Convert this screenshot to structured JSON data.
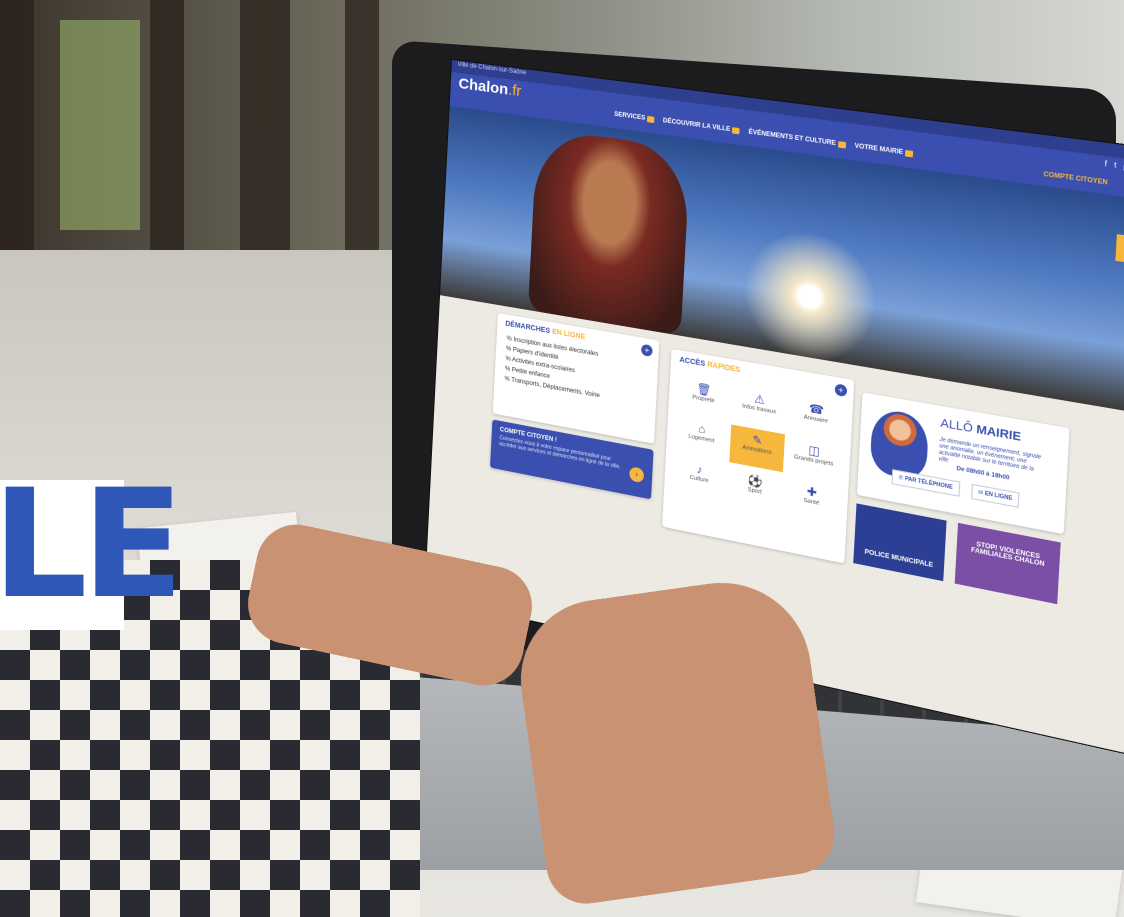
{
  "overlay": {
    "big_letters": "LE"
  },
  "site": {
    "topbar": "Ville de Chalon-sur-Saône",
    "brand": {
      "name": "Chalon",
      "tld": ".fr"
    },
    "nav": [
      "SERVICES",
      "DÉCOUVRIR LA VILLE",
      "ÉVÉNEMENTS ET CULTURE",
      "VOTRE MAIRIE"
    ],
    "social_icons": [
      "f",
      "t",
      "▶",
      "◎"
    ],
    "account_label": "COMPTE CITOYEN",
    "search_icon": "⌕",
    "demarches": {
      "title_prefix": "DÉMARCHES",
      "title_accent": "EN LIGNE",
      "links": [
        "% Inscription aux listes électorales",
        "% Papiers d'identité",
        "% Activités extra-scolaires",
        "% Petite enfance",
        "% Transports, Déplacements, Voirie"
      ]
    },
    "citizen": {
      "title": "COMPTE CITOYEN !",
      "text": "Connectez-vous à votre espace personnalisé pour accéder aux services et démarches en ligne de la ville."
    },
    "acces": {
      "title_prefix": "ACCÈS",
      "title_accent": "RAPIDES",
      "tiles": [
        {
          "label": "Propreté",
          "icon": "🗑"
        },
        {
          "label": "Infos travaux",
          "icon": "⚠"
        },
        {
          "label": "Annuaire",
          "icon": "☎"
        },
        {
          "label": "Logement",
          "icon": "⌂"
        },
        {
          "label": "Animations",
          "icon": "✎"
        },
        {
          "label": "Grands projets",
          "icon": "◫"
        },
        {
          "label": "Culture",
          "icon": "♪"
        },
        {
          "label": "Sport",
          "icon": "⚽"
        },
        {
          "label": "Santé",
          "icon": "✚"
        }
      ]
    },
    "allo": {
      "title_prefix": "ALLÔ",
      "title_bold": "MAIRIE",
      "text": "Je demande un renseignement, signale une anomalie, un événement, une actualité notable sur le territoire de la ville",
      "hours": "De 08h00 à 18h00",
      "phone_button": "PAR TÉLÉPHONE",
      "online_button": "EN LIGNE"
    },
    "banners": {
      "police": "POLICE MUNICIPALE",
      "violence": "STOP! VIOLENCES FAMILIALES CHALON"
    }
  },
  "colors": {
    "brand_blue": "#3a4fb0",
    "accent_yellow": "#f6b73c"
  }
}
